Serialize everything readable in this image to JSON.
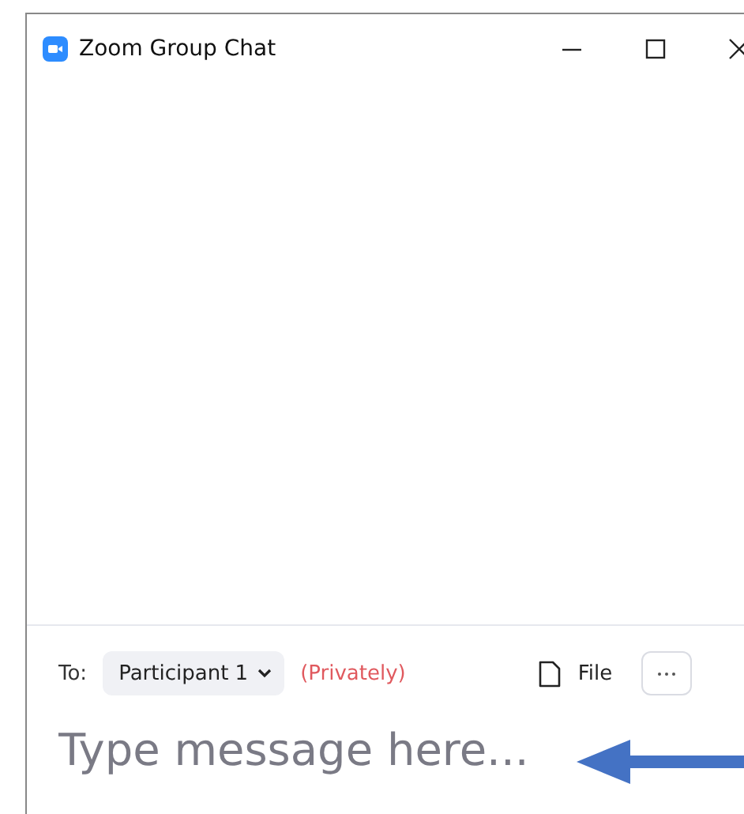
{
  "window": {
    "title": "Zoom Group Chat"
  },
  "composer": {
    "to_label": "To:",
    "recipient": "Participant 1",
    "privacy": "(Privately)",
    "file_label": "File",
    "placeholder": "Type message here..."
  }
}
